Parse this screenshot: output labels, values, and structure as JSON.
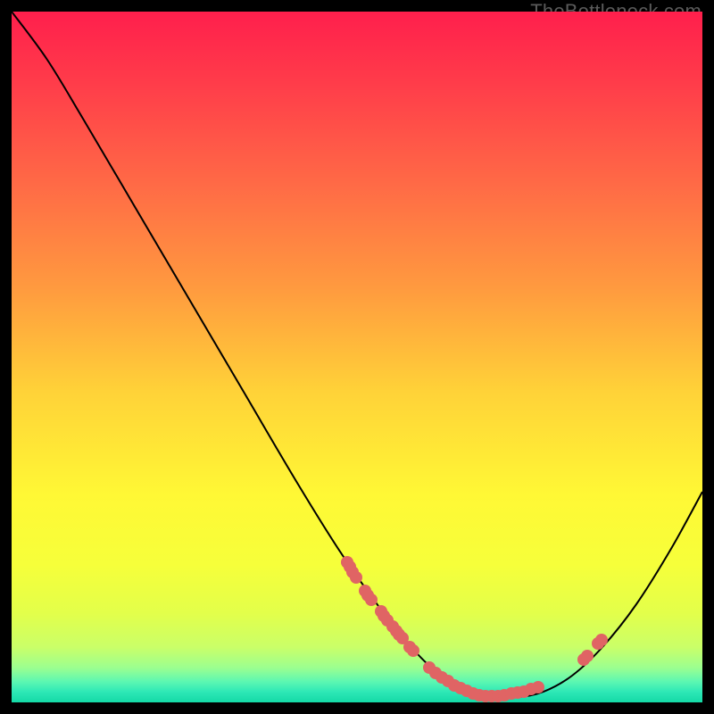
{
  "watermark": "TheBottleneck.com",
  "chart_data": {
    "type": "line",
    "title": "",
    "xlabel": "",
    "ylabel": "",
    "x_range": [
      0,
      774
    ],
    "y_range_display": [
      0,
      774
    ],
    "curve_points": [
      [
        0,
        0
      ],
      [
        40,
        54
      ],
      [
        80,
        120
      ],
      [
        140,
        222
      ],
      [
        200,
        324
      ],
      [
        260,
        426
      ],
      [
        320,
        528
      ],
      [
        370,
        608
      ],
      [
        420,
        678
      ],
      [
        455,
        720
      ],
      [
        485,
        747
      ],
      [
        515,
        762
      ],
      [
        540,
        768
      ],
      [
        568,
        768
      ],
      [
        596,
        762
      ],
      [
        628,
        744
      ],
      [
        662,
        712
      ],
      [
        700,
        664
      ],
      [
        740,
        600
      ],
      [
        774,
        538
      ]
    ],
    "dots_left_cluster": [
      [
        376,
        617
      ],
      [
        379,
        622
      ],
      [
        382,
        628
      ],
      [
        386,
        634
      ],
      [
        396,
        649
      ],
      [
        399,
        654
      ],
      [
        403,
        659
      ],
      [
        414,
        672
      ],
      [
        417,
        677
      ],
      [
        421,
        682
      ],
      [
        427,
        689
      ],
      [
        431,
        694
      ],
      [
        434,
        698
      ],
      [
        438,
        702
      ],
      [
        446,
        712
      ],
      [
        450,
        716
      ]
    ],
    "dots_bottom_row": [
      [
        468,
        735
      ],
      [
        475,
        741
      ],
      [
        482,
        746
      ],
      [
        489,
        750
      ],
      [
        496,
        755
      ],
      [
        503,
        758
      ],
      [
        510,
        761
      ],
      [
        517,
        764
      ],
      [
        524,
        766
      ],
      [
        531,
        767
      ],
      [
        538,
        767
      ],
      [
        545,
        767
      ],
      [
        552,
        766
      ],
      [
        560,
        764
      ],
      [
        567,
        763
      ],
      [
        574,
        762
      ],
      [
        582,
        759
      ],
      [
        590,
        757
      ]
    ],
    "dots_right_cluster": [
      [
        641,
        726
      ],
      [
        645,
        722
      ],
      [
        657,
        708
      ],
      [
        661,
        704
      ]
    ],
    "gradient_stops": [
      {
        "offset": 0.0,
        "color": "#ff1f4c"
      },
      {
        "offset": 0.1,
        "color": "#ff3b4a"
      },
      {
        "offset": 0.25,
        "color": "#ff6a46"
      },
      {
        "offset": 0.4,
        "color": "#ff9a3f"
      },
      {
        "offset": 0.55,
        "color": "#ffd238"
      },
      {
        "offset": 0.7,
        "color": "#fff835"
      },
      {
        "offset": 0.8,
        "color": "#f6ff3a"
      },
      {
        "offset": 0.87,
        "color": "#e3ff4a"
      },
      {
        "offset": 0.92,
        "color": "#caff68"
      },
      {
        "offset": 0.95,
        "color": "#9bff90"
      },
      {
        "offset": 0.97,
        "color": "#5cf7b2"
      },
      {
        "offset": 0.985,
        "color": "#2de8b6"
      },
      {
        "offset": 1.0,
        "color": "#14d9a6"
      }
    ],
    "dot_radius": 7,
    "line_color": "#000000",
    "line_width": 2
  }
}
